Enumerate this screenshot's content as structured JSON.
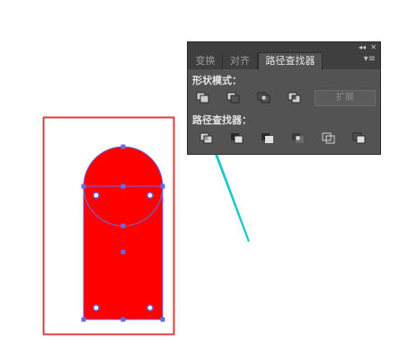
{
  "panel": {
    "tabs": [
      {
        "label": "变换"
      },
      {
        "label": "对齐"
      },
      {
        "label": "路径查找器"
      }
    ],
    "active_tab_index": 2,
    "collapse_glyph": "◂◂",
    "close_glyph": "✕",
    "menu_glyph": "▾≡",
    "shape_modes": {
      "label": "形状模式：",
      "buttons": [
        {
          "name": "unite-icon"
        },
        {
          "name": "minus-front-icon"
        },
        {
          "name": "intersect-icon"
        },
        {
          "name": "exclude-icon"
        }
      ],
      "expand_label": "扩展"
    },
    "pathfinders": {
      "label": "路径查找器：",
      "buttons": [
        {
          "name": "divide-icon"
        },
        {
          "name": "trim-icon"
        },
        {
          "name": "merge-icon"
        },
        {
          "name": "crop-icon"
        },
        {
          "name": "outline-icon"
        },
        {
          "name": "minus-back-icon"
        }
      ]
    }
  },
  "colors": {
    "shape_fill": "#ff0000",
    "selection": "#6a6adf",
    "frame": "#d84040",
    "arrow": "#21c7cc",
    "panel_bg": "#535353"
  }
}
